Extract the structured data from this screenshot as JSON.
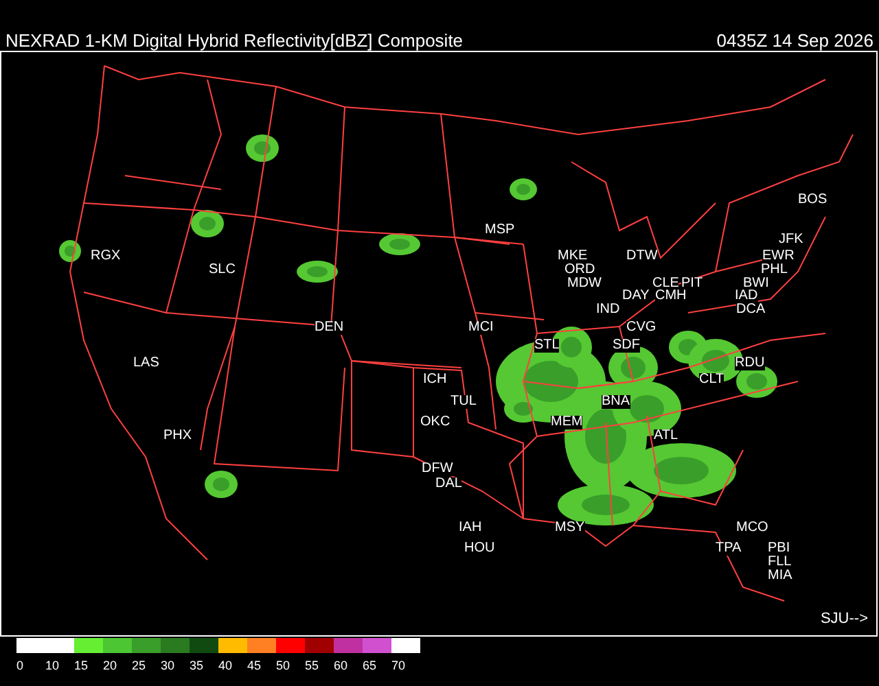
{
  "header": {
    "title": "NEXRAD 1-KM Digital Hybrid Reflectivity[dBZ] Composite",
    "timestamp": "0435Z 14 Sep 2026"
  },
  "map": {
    "cities": [
      "BOS",
      "MSP",
      "JFK",
      "RGX",
      "MKE",
      "DTW",
      "EWR",
      "SLC",
      "ORD",
      "PHL",
      "MDW",
      "CLE",
      "PIT",
      "BWI",
      "DAY",
      "CMH",
      "IAD",
      "IND",
      "DCA",
      "DEN",
      "MCI",
      "CVG",
      "STL",
      "SDF",
      "LAS",
      "RDU",
      "ICH",
      "CLT",
      "TUL",
      "BNA",
      "OKC",
      "MEM",
      "PHX",
      "ATL",
      "DFW",
      "DAL",
      "IAH",
      "MSY",
      "MCO",
      "HOU",
      "TPA",
      "PBI",
      "FLL",
      "MIA"
    ],
    "pointer_label": "SJU-->"
  },
  "legend": {
    "swatches": [
      {
        "color": "#ffffff"
      },
      {
        "color": "#66ee33"
      },
      {
        "color": "#4cc633"
      },
      {
        "color": "#3a9e2a"
      },
      {
        "color": "#2a7a20"
      },
      {
        "color": "#104a10"
      },
      {
        "color": "#ffbb00"
      },
      {
        "color": "#ff8022"
      },
      {
        "color": "#ff0000"
      },
      {
        "color": "#a00000"
      },
      {
        "color": "#c030a0"
      },
      {
        "color": "#d050d0"
      },
      {
        "color": "#ffffff"
      }
    ],
    "ticks": [
      "0",
      "10",
      "15",
      "20",
      "25",
      "30",
      "35",
      "40",
      "45",
      "50",
      "55",
      "60",
      "65",
      "70"
    ]
  }
}
